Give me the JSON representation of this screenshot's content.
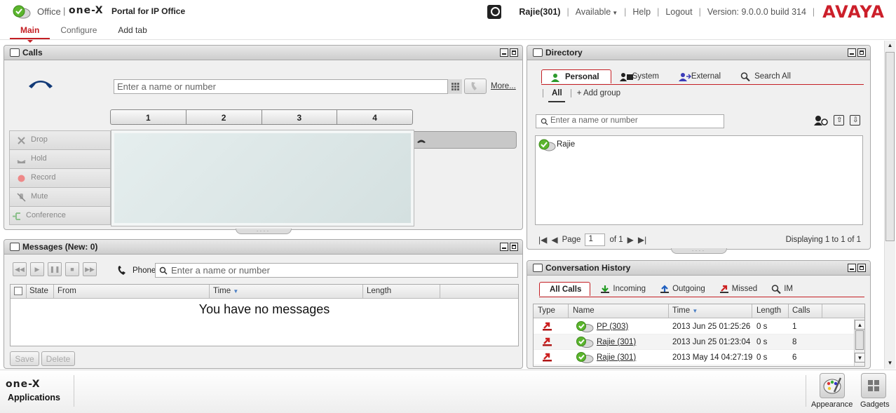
{
  "header": {
    "office_label": "Office",
    "logo_separator": "|",
    "onex_logo_text": "one-X",
    "portal_title": "Portal for IP Office",
    "user_name": "Rajie(301)",
    "status": "Available",
    "help": "Help",
    "logout": "Logout",
    "version": "Version: 9.0.0.0 build 314",
    "brand": "AVAYA",
    "separator": "|"
  },
  "tabs": [
    "Main",
    "Configure",
    "Add tab"
  ],
  "calls": {
    "title": "Calls",
    "dial_placeholder": "Enter a name or number",
    "more": "More...",
    "lines": [
      "1",
      "2",
      "3",
      "4"
    ],
    "actions": [
      "Drop",
      "Hold",
      "Record",
      "Mute",
      "Conference"
    ]
  },
  "messages": {
    "title": "Messages (New: 0)",
    "phone_label": "Phone",
    "search_placeholder": "Enter a name or number",
    "columns": [
      "State",
      "From",
      "Time",
      "Length"
    ],
    "empty_text": "You have no messages",
    "save": "Save",
    "delete": "Delete"
  },
  "directory": {
    "title": "Directory",
    "tabs": [
      "Personal",
      "System",
      "External",
      "Search All"
    ],
    "subtabs": {
      "all": "All",
      "add_group": "+ Add group"
    },
    "search_placeholder": "Enter a name or number",
    "contacts": [
      "Rajie"
    ],
    "pager": {
      "page_label": "Page",
      "page_value": "1",
      "of_label": "of 1"
    },
    "displaying": "Displaying 1 to 1 of 1"
  },
  "history": {
    "title": "Conversation History",
    "tabs": [
      "All Calls",
      "Incoming",
      "Outgoing",
      "Missed",
      "IM"
    ],
    "columns": [
      "Type",
      "Name",
      "Time",
      "Length",
      "Calls"
    ],
    "rows": [
      {
        "name": "PP (303)",
        "time": "2013 Jun 25 01:25:26",
        "length": "0 s",
        "calls": "1"
      },
      {
        "name": "Rajie (301)",
        "time": "2013 Jun 25 01:23:04",
        "length": "0 s",
        "calls": "8"
      },
      {
        "name": "Rajie (301)",
        "time": "2013 May 14 04:27:19",
        "length": "0 s",
        "calls": "6"
      }
    ]
  },
  "dock": {
    "onex_logo_text": "one-X",
    "applications": "Applications",
    "appearance": "Appearance",
    "gadgets": "Gadgets"
  },
  "colors": {
    "accent": "#c41f24",
    "brand": "#cc1f2a",
    "presence_green": "#5bb52d",
    "missed_red": "#cc2020"
  },
  "icons": [
    "presence-icon",
    "handset-icon",
    "keypad-icon",
    "phone-icon",
    "search-icon",
    "missed-call-icon",
    "palette-icon",
    "grid-icon"
  ]
}
